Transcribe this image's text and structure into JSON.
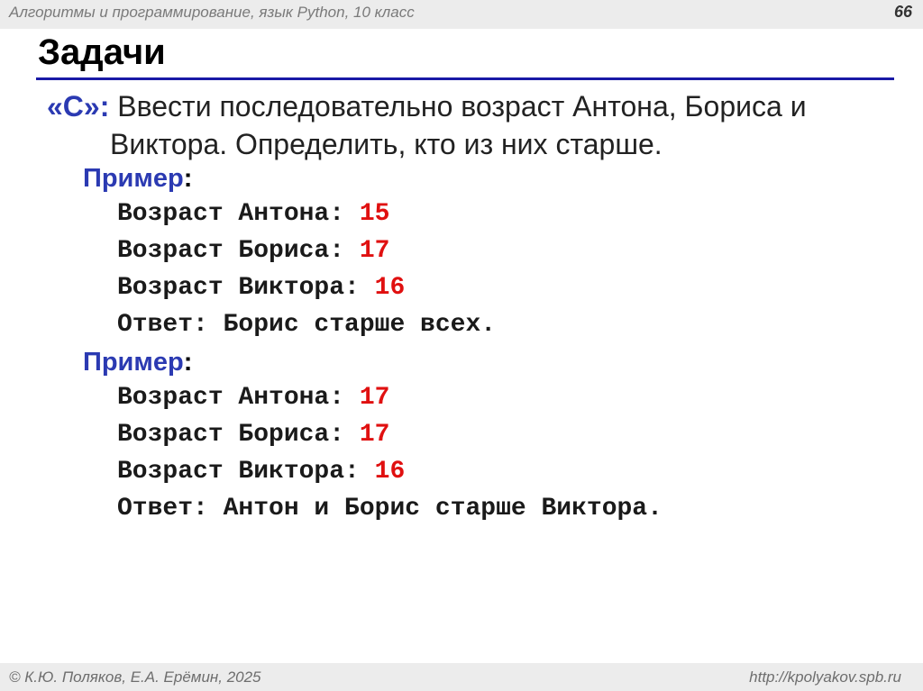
{
  "header": {
    "course": "Алгоритмы и программирование, язык Python, 10 класс",
    "page": "66"
  },
  "title": "Задачи",
  "task": {
    "label": "«C»:",
    "line1": "Ввести последовательно возраст Антона, Бориса и",
    "line2": "Виктора. Определить, кто из них старше."
  },
  "examples": [
    {
      "label": "Пример",
      "lines": [
        {
          "text": "Возраст Антона: ",
          "value": "15"
        },
        {
          "text": "Возраст Бориса: ",
          "value": "17"
        },
        {
          "text": "Возраст Виктора: ",
          "value": "16"
        },
        {
          "text": "Ответ: Борис старше всех.",
          "value": ""
        }
      ]
    },
    {
      "label": "Пример",
      "lines": [
        {
          "text": "Возраст Антона: ",
          "value": "17"
        },
        {
          "text": "Возраст Бориса: ",
          "value": "17"
        },
        {
          "text": "Возраст Виктора: ",
          "value": "16"
        },
        {
          "text": "Ответ: Антон и Борис старше Виктора.",
          "value": ""
        }
      ]
    }
  ],
  "footer": {
    "copyright": "© К.Ю. Поляков, Е.А. Ерёмин, 2025",
    "link": "http://kpolyakov.spb.ru"
  }
}
